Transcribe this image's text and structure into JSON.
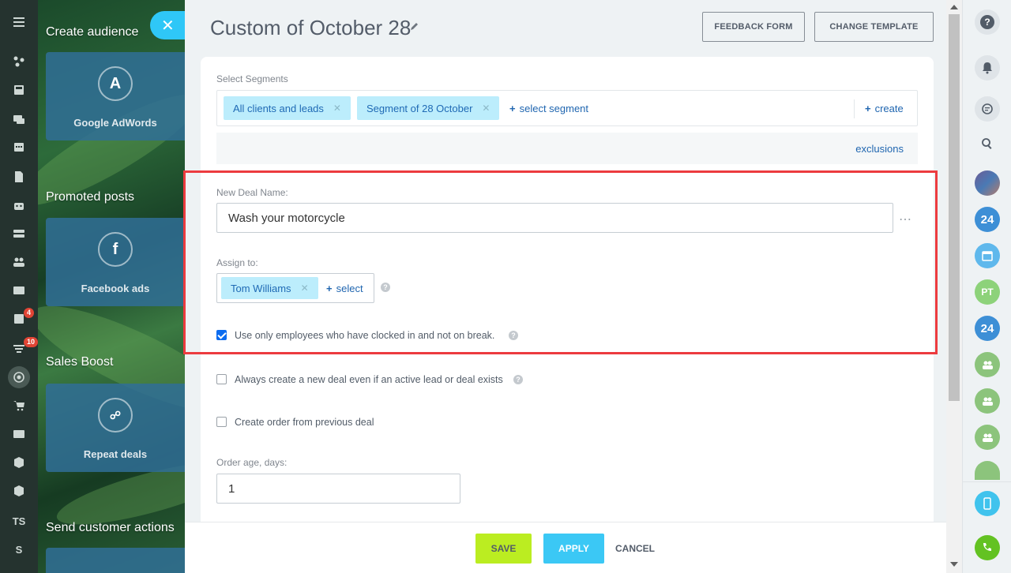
{
  "left_rail": {
    "badges": {
      "tasks": "4",
      "filters": "10"
    },
    "text_items": [
      "TS",
      "S"
    ]
  },
  "marketing_panel": {
    "sections": [
      {
        "title": "Create audience",
        "tile": "Google AdWords",
        "icon": "adwords-icon"
      },
      {
        "title": "Promoted posts",
        "tile": "Facebook ads",
        "icon": "facebook-icon"
      },
      {
        "title": "Sales Boost",
        "tile": "Repeat deals",
        "icon": "handshake-icon"
      },
      {
        "title": "Send customer actions",
        "tile": "",
        "icon": ""
      }
    ]
  },
  "header": {
    "title": "Custom of October 28",
    "feedback_button": "FEEDBACK FORM",
    "change_template_button": "CHANGE TEMPLATE"
  },
  "segments": {
    "label": "Select Segments",
    "selected": [
      "All clients and leads",
      "Segment of 28 October"
    ],
    "select_link": "select segment",
    "create_link": "create",
    "exclusions_link": "exclusions"
  },
  "deal": {
    "name_label": "New Deal Name:",
    "name_value": "Wash your motorcycle",
    "assign_label": "Assign to:",
    "assignee": "Tom Williams",
    "assign_select_link": "select",
    "clocked_in_option": "Use only employees who have clocked in and not on break.",
    "clocked_in_checked": true
  },
  "options": {
    "always_new_deal": "Always create a new deal even if an active lead or deal exists",
    "always_new_deal_checked": false,
    "create_order": "Create order from previous deal",
    "create_order_checked": false,
    "order_age_label": "Order age, days:",
    "order_age_value": "1"
  },
  "footer": {
    "save": "SAVE",
    "apply": "APPLY",
    "cancel": "CANCEL"
  },
  "right_sidebar": {
    "avatar_24_label": "24",
    "avatar_pt_label": "PT"
  },
  "colors": {
    "accent_blue": "#2fc7f7",
    "save_green": "#bbed21",
    "highlight_red": "#ec3b3f",
    "tag_bg": "#bcedfc"
  }
}
